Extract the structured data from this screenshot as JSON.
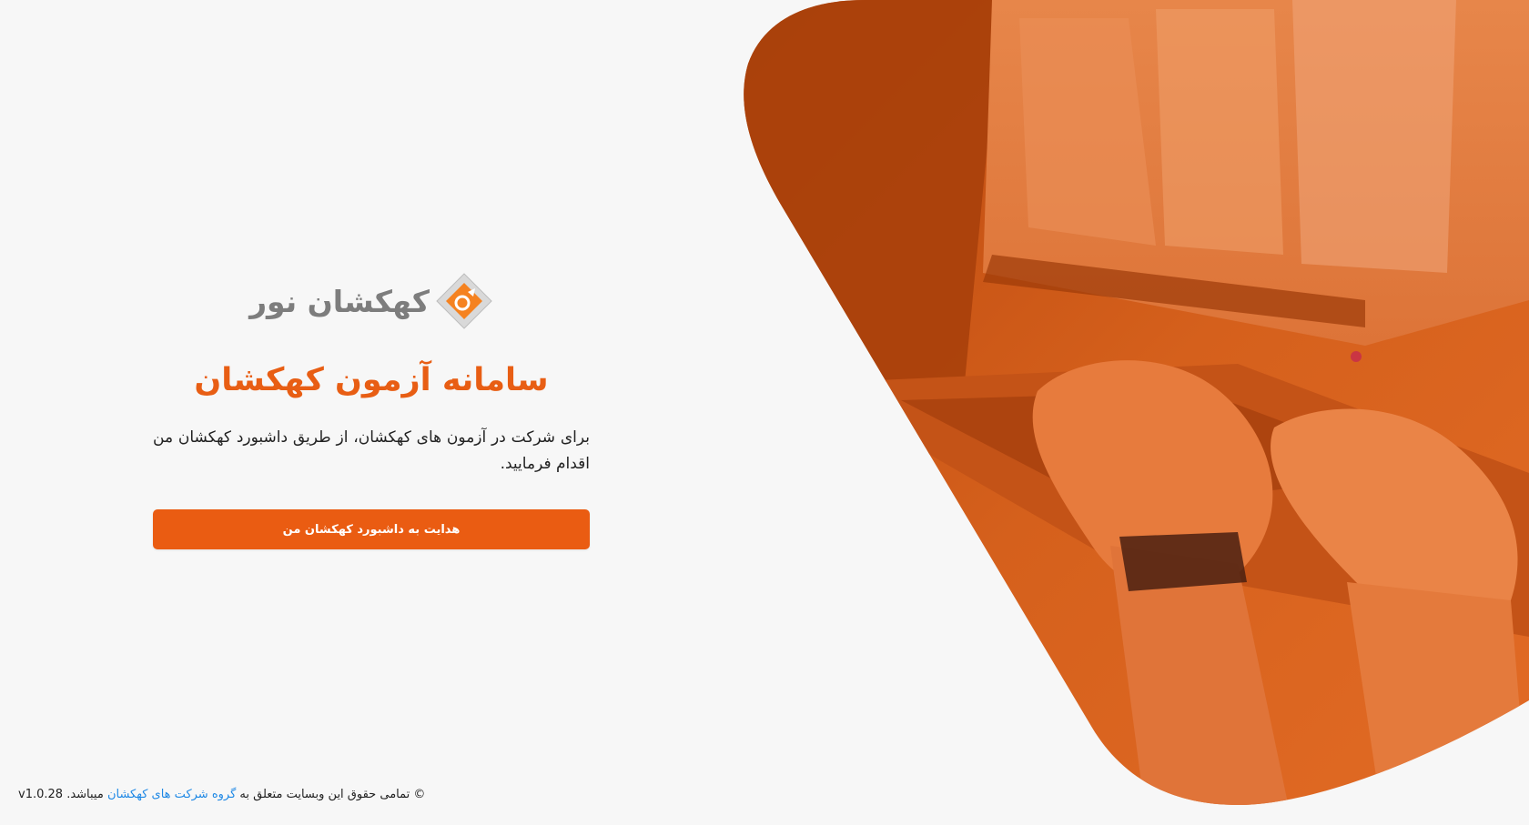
{
  "brand": {
    "logo_text": "کهکشان نور",
    "logo_icon": "galaxy-logo-icon"
  },
  "main": {
    "title": "سامانه آزمون کهکشان",
    "description": "برای شرکت در آزمون های کهکشان، از طریق داشبورد کهکشان من اقدام فرمایید.",
    "cta_label": "هدایت به داشبورد کهکشان من"
  },
  "footer": {
    "copyright_prefix": "© تمامی حقوق این وبسایت متعلق به",
    "company_link": "گروه شرکت های کهکشان",
    "copyright_suffix": "میباشد.",
    "version": "v1.0.28"
  },
  "colors": {
    "accent": "#ea5c12",
    "title": "#e85e14",
    "link": "#1e88e5",
    "background": "#f7f7f7"
  }
}
